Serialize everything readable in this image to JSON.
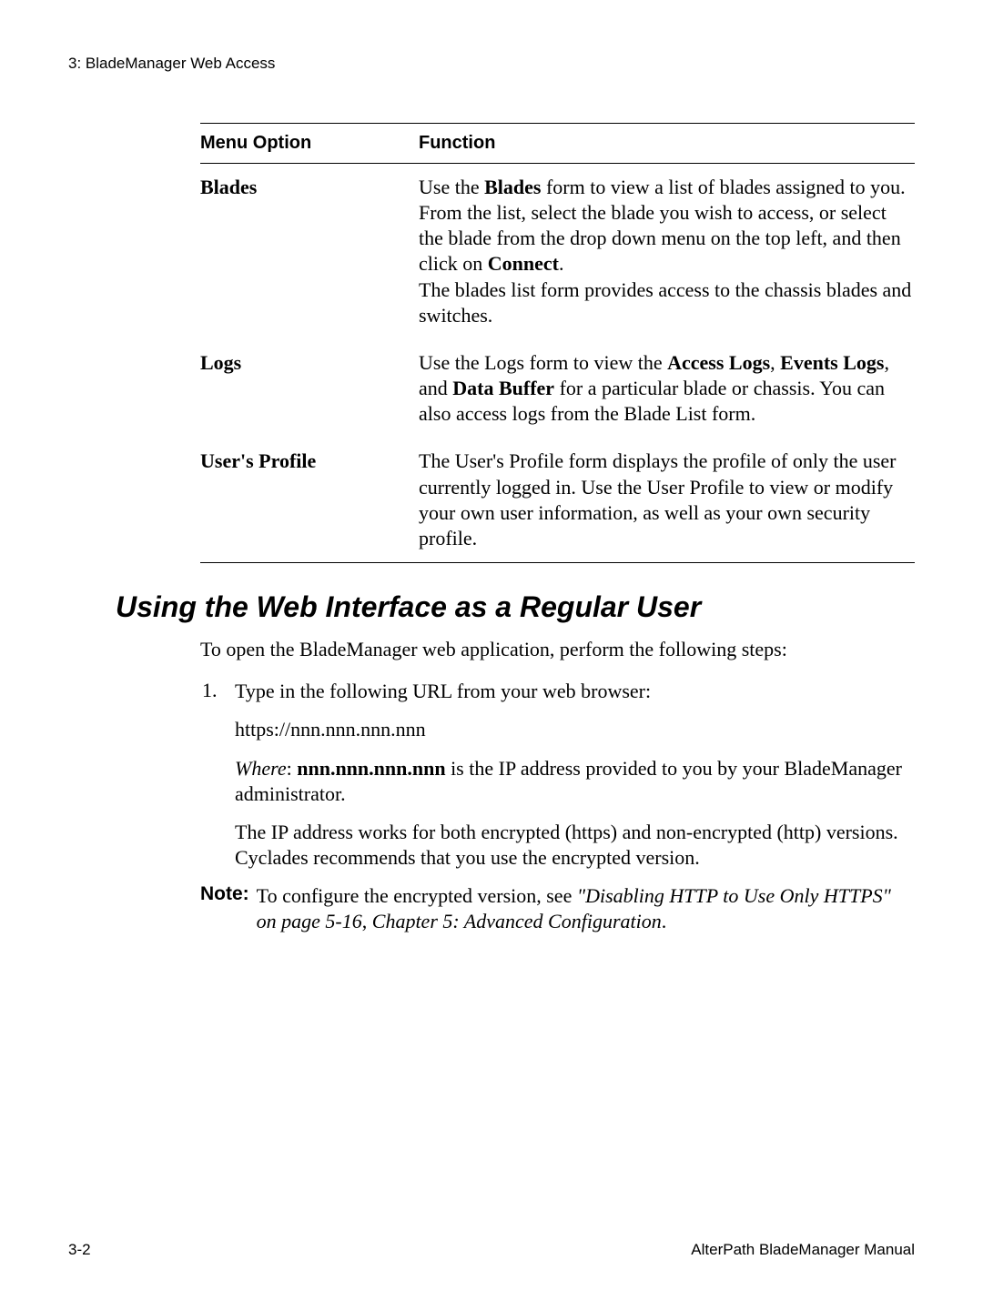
{
  "chapter_header": "3: BladeManager Web Access",
  "table": {
    "headers": {
      "col1": "Menu Option",
      "col2": "Function"
    },
    "rows": [
      {
        "option": "Blades",
        "pre1": "Use the ",
        "bold1": "Blades",
        "mid1": " form to view a list of blades assigned to you. From the list, select the blade you wish to access, or select the blade from the drop down menu on the top left, and then click on ",
        "bold2": "Connect",
        "post1": ".",
        "line2": "The blades list form provides access to the chassis blades and switches."
      },
      {
        "option": "Logs",
        "pre1": "Use the Logs form to view the ",
        "bold1": "Access Logs",
        "mid1": ", ",
        "bold2": "Events Logs",
        "mid2": ", and ",
        "bold3": "Data Buffer",
        "post1": " for a particular blade or chassis. You can also access logs from the Blade List form."
      },
      {
        "option": "User's Profile",
        "text": "The User's Profile form displays the profile of only the user currently logged in. Use the User Profile to view or modify your own user information, as well as your own security profile."
      }
    ]
  },
  "section_heading": "Using the Web Interface as a Regular User",
  "intro": "To open the BladeManager web application, perform the following steps:",
  "step1": {
    "num": "1.",
    "text": "Type in the following URL from your web browser:"
  },
  "url_line": "https://nnn.nnn.nnn.nnn",
  "where": {
    "label": "Where",
    "sep": ": ",
    "bold": "nnn.nnn.nnn.nnn",
    "rest": " is the IP address provided to you by your BladeManager administrator."
  },
  "ip_text": "The IP address works for both encrypted (https) and non-encrypted (http) versions. Cyclades recommends that you use the encrypted version.",
  "note": {
    "label": "Note:",
    "pre": " To configure the encrypted version, see ",
    "italic1": "\"Disabling HTTP to Use Only HTTPS\" on page 5-16",
    "sep": ", ",
    "italic2": "Chapter 5: Advanced Configuration",
    "end": "."
  },
  "footer": {
    "left": "3-2",
    "right": "AlterPath BladeManager Manual"
  }
}
